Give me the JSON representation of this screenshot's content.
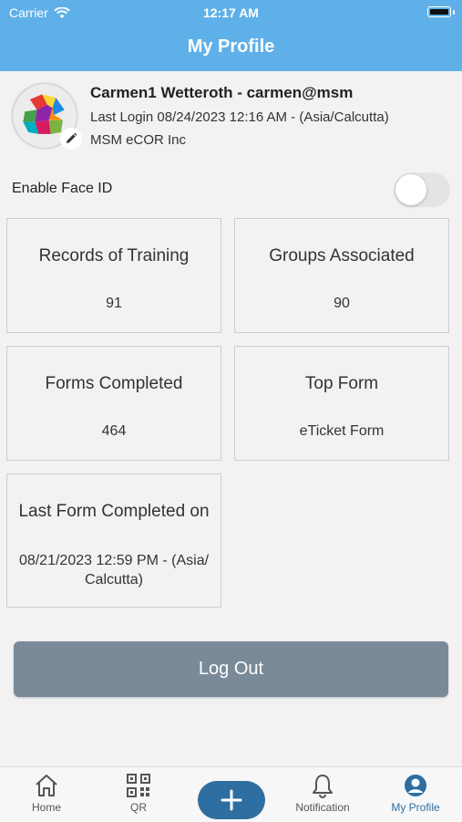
{
  "status_bar": {
    "carrier": "Carrier",
    "time": "12:17 AM"
  },
  "header": {
    "title": "My Profile"
  },
  "profile": {
    "name_line": "Carmen1 Wetteroth - carmen@msm",
    "last_login": "Last Login 08/24/2023 12:16 AM - (Asia/Calcutta)",
    "organization": "MSM eCOR Inc"
  },
  "face_id": {
    "label": "Enable Face ID",
    "enabled": false
  },
  "stats": [
    {
      "title": "Records of Training",
      "value": "91"
    },
    {
      "title": "Groups Associated",
      "value": "90"
    },
    {
      "title": "Forms Completed",
      "value": "464"
    },
    {
      "title": "Top Form",
      "value": "eTicket Form"
    },
    {
      "title": "Last Form Completed on",
      "value": "08/21/2023 12:59 PM - (Asia/ Calcutta)"
    }
  ],
  "logout_label": "Log Out",
  "tabs": [
    {
      "label": "Home",
      "icon": "home-icon"
    },
    {
      "label": "QR",
      "icon": "qr-icon"
    },
    {
      "label": "",
      "icon": "plus-icon"
    },
    {
      "label": "Notification",
      "icon": "bell-icon"
    },
    {
      "label": "My Profile",
      "icon": "profile-icon",
      "active": true
    }
  ],
  "colors": {
    "header": "#5fb0e8",
    "accent": "#2f6ea0",
    "logout": "#7a8a99"
  }
}
